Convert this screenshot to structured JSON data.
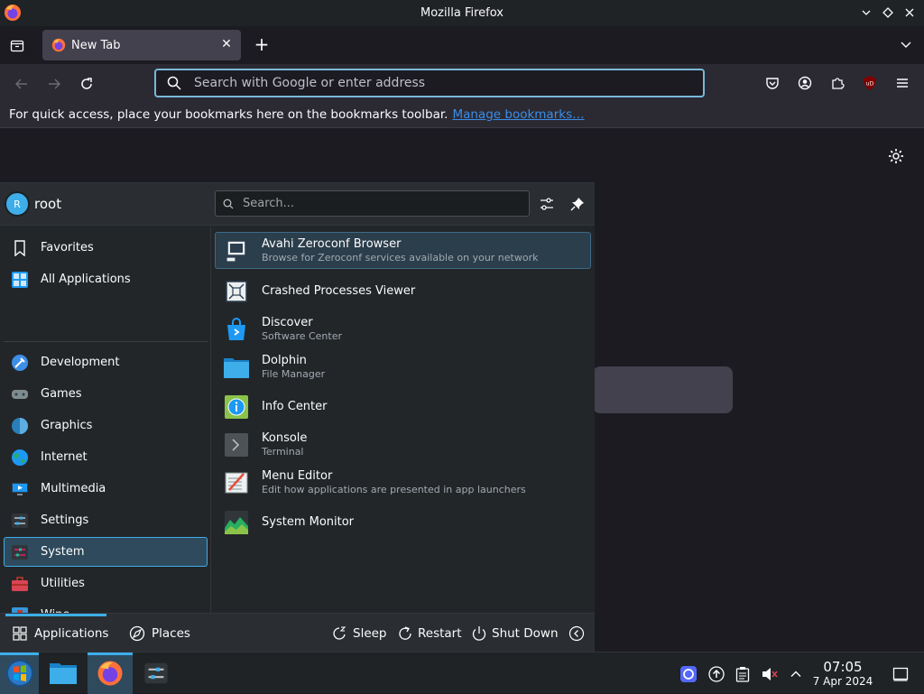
{
  "window": {
    "title": "Mozilla Firefox",
    "controls": [
      "minimize",
      "maximize",
      "close"
    ]
  },
  "tabs": [
    {
      "label": "New Tab",
      "icon": "firefox-icon",
      "active": true
    }
  ],
  "navbar": {
    "url_placeholder": "Search with Google or enter address",
    "toolbar_icons": [
      "pocket-icon",
      "account-icon",
      "extensions-icon",
      "ublock-origin-icon",
      "menu-icon"
    ]
  },
  "bookmarks_bar": {
    "message": "For quick access, place your bookmarks here on the bookmarks toolbar.",
    "link": "Manage bookmarks…"
  },
  "launcher": {
    "user": {
      "initial": "R",
      "name": "root"
    },
    "search_placeholder": "Search...",
    "categories": [
      {
        "label": "Favorites",
        "icon": "bookmark-icon"
      },
      {
        "label": "All Applications",
        "icon": "grid-icon"
      },
      {
        "label": "Development",
        "icon": "development-icon"
      },
      {
        "label": "Games",
        "icon": "gamepad-icon"
      },
      {
        "label": "Graphics",
        "icon": "graphics-icon"
      },
      {
        "label": "Internet",
        "icon": "globe-icon"
      },
      {
        "label": "Multimedia",
        "icon": "multimedia-icon"
      },
      {
        "label": "Settings",
        "icon": "settings-icon"
      },
      {
        "label": "System",
        "icon": "system-icon",
        "selected": true
      },
      {
        "label": "Utilities",
        "icon": "toolbox-icon"
      },
      {
        "label": "Wine",
        "icon": "wine-icon"
      }
    ],
    "apps": [
      {
        "name": "Avahi Zeroconf Browser",
        "desc": "Browse for Zeroconf services available on your network",
        "icon": "network-icon",
        "highlighted": true
      },
      {
        "name": "Crashed Processes Viewer",
        "desc": "",
        "icon": "crash-icon"
      },
      {
        "name": "Discover",
        "desc": "Software Center",
        "icon": "discover-bag-icon"
      },
      {
        "name": "Dolphin",
        "desc": "File Manager",
        "icon": "folder-icon"
      },
      {
        "name": "Info Center",
        "desc": "",
        "icon": "info-icon"
      },
      {
        "name": "Konsole",
        "desc": "Terminal",
        "icon": "terminal-icon"
      },
      {
        "name": "Menu Editor",
        "desc": "Edit how applications are presented in app launchers",
        "icon": "menu-editor-icon"
      },
      {
        "name": "System Monitor",
        "desc": "",
        "icon": "system-monitor-icon"
      }
    ],
    "footer": {
      "applications": "Applications",
      "places": "Places",
      "sleep": "Sleep",
      "restart": "Restart",
      "shutdown": "Shut Down"
    }
  },
  "taskbar": {
    "clock_time": "07:05",
    "clock_date": "7 Apr 2024"
  },
  "colors": {
    "accent": "#3daee9",
    "panel_bg": "#232629",
    "firefox_link": "#3b8ee8"
  }
}
